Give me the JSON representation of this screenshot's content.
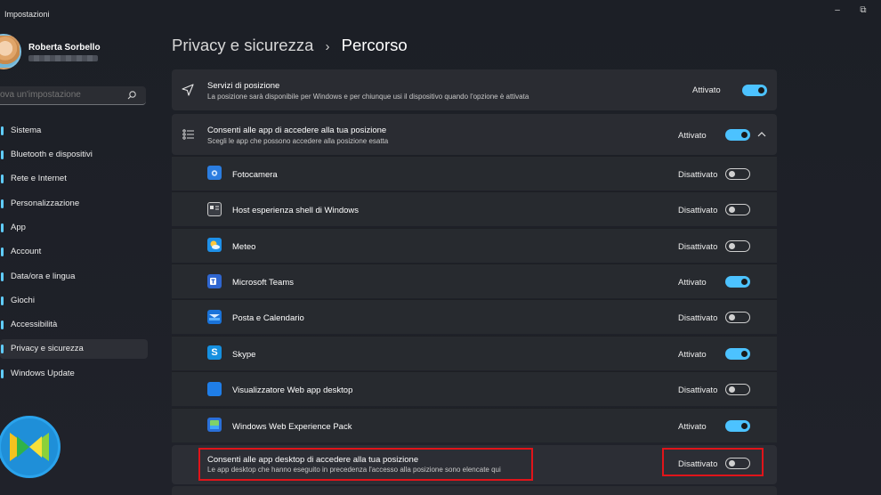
{
  "window": {
    "title": "Impostazioni",
    "minimize": "–",
    "restore": "⧉"
  },
  "user": {
    "name": "Roberta Sorbello"
  },
  "search": {
    "placeholder": "ova un'impostazione"
  },
  "sidebar": {
    "items": [
      {
        "label": "Sistema"
      },
      {
        "label": "Bluetooth e dispositivi"
      },
      {
        "label": "Rete e Internet"
      },
      {
        "label": "Personalizzazione"
      },
      {
        "label": "App"
      },
      {
        "label": "Account"
      },
      {
        "label": "Data/ora e lingua"
      },
      {
        "label": "Giochi"
      },
      {
        "label": "Accessibilità"
      },
      {
        "label": "Privacy e sicurezza",
        "active": true
      },
      {
        "label": "Windows Update"
      }
    ]
  },
  "breadcrumb": {
    "parent": "Privacy e sicurezza",
    "separator": "›",
    "current": "Percorso"
  },
  "location_service": {
    "title": "Servizi di posizione",
    "subtitle": "La posizione sarà disponibile per Windows e per chiunque usi il dispositivo quando l'opzione è attivata",
    "status": "Attivato",
    "on": true
  },
  "app_access": {
    "title": "Consenti alle app di accedere alla tua posizione",
    "subtitle": "Scegli le app che possono accedere alla posizione esatta",
    "status": "Attivato",
    "on": true,
    "apps": [
      {
        "name": "Fotocamera",
        "status": "Disattivato",
        "on": false,
        "icon": "camera-icon",
        "color": "#2b7de0"
      },
      {
        "name": "Host esperienza shell di Windows",
        "status": "Disattivato",
        "on": false,
        "icon": "shell-host-icon",
        "color": "#c8c8c8"
      },
      {
        "name": "Meteo",
        "status": "Disattivato",
        "on": false,
        "icon": "weather-icon",
        "color": "#1e90e8"
      },
      {
        "name": "Microsoft Teams",
        "status": "Attivato",
        "on": true,
        "icon": "teams-icon",
        "color": "#2f66d0"
      },
      {
        "name": "Posta e Calendario",
        "status": "Disattivato",
        "on": false,
        "icon": "mail-calendar-icon",
        "color": "#1a73d9"
      },
      {
        "name": "Skype",
        "status": "Attivato",
        "on": true,
        "icon": "skype-icon",
        "color": "#1590e0"
      },
      {
        "name": "Visualizzatore Web app desktop",
        "status": "Disattivato",
        "on": false,
        "icon": "web-viewer-icon",
        "color": "#1f7ee8"
      },
      {
        "name": "Windows Web Experience Pack",
        "status": "Attivato",
        "on": true,
        "icon": "web-experience-icon",
        "color": "#2a6fd8"
      }
    ]
  },
  "desktop_apps": {
    "title": "Consenti alle app desktop di accedere alla tua posizione",
    "subtitle": "Le app desktop che hanno eseguito in precedenza l'accesso alla posizione sono elencate qui",
    "status": "Disattivato",
    "on": false
  },
  "colors": {
    "accent": "#4cc2ff",
    "highlight": "#e0141a",
    "card": "#2a2c32"
  }
}
